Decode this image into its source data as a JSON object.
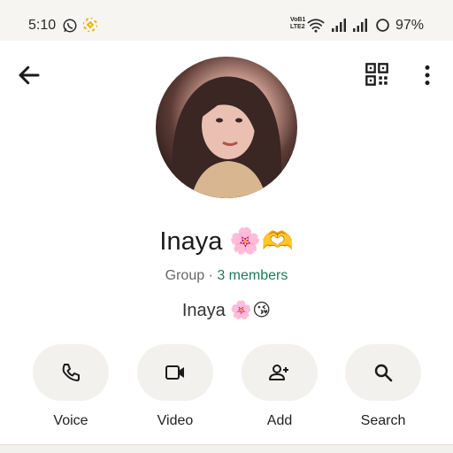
{
  "status_bar": {
    "time": "5:10",
    "volte_line1": "VoB1",
    "volte_line2": "LTE2",
    "battery": "97%"
  },
  "profile": {
    "name": "Inaya 🌸🫶",
    "subtitle_type": "Group",
    "subtitle_separator": " · ",
    "members": "3 members",
    "description": "Inaya 🌸😘"
  },
  "actions": [
    {
      "label": "Voice",
      "icon": "phone-icon"
    },
    {
      "label": "Video",
      "icon": "video-icon"
    },
    {
      "label": "Add",
      "icon": "add-user-icon"
    },
    {
      "label": "Search",
      "icon": "search-icon"
    }
  ],
  "colors": {
    "accent": "#1f7a57",
    "button_bg": "#f3f1ee",
    "status_bar_bg": "#f7f5f2"
  }
}
